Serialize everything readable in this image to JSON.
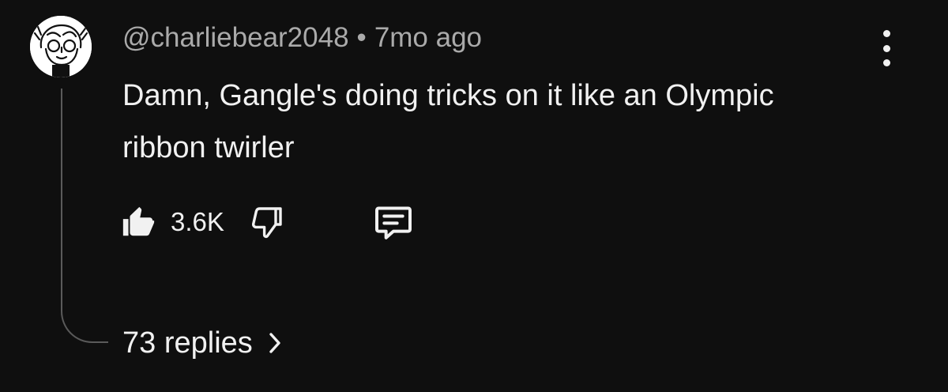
{
  "comment": {
    "author_handle": "@charliebear2048",
    "separator": "•",
    "time_ago": "7mo ago",
    "text": "Damn, Gangle's doing tricks on it like an Olympic ribbon twirler",
    "like_count": "3.6K",
    "replies_label": "73 replies"
  },
  "icons": {
    "avatar": "avatar-image",
    "more": "more-vert-icon",
    "like": "thumb-up-filled-icon",
    "dislike": "thumb-down-outline-icon",
    "reply": "comment-reply-icon",
    "replies_chevron": "chevron-right-icon"
  },
  "colors": {
    "background": "#0f0f0f",
    "primary_text": "#f1f1f1",
    "secondary_text": "#aaaaaa",
    "thread_line": "#5a5a5a"
  }
}
